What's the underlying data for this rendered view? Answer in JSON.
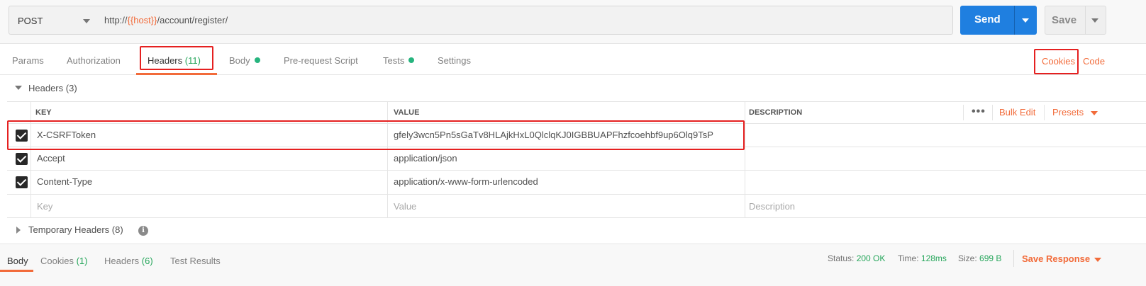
{
  "request": {
    "method": "POST",
    "url_prefix": "http://",
    "url_var": "{{host}}",
    "url_suffix": "/account/register/",
    "send_label": "Send",
    "save_label": "Save"
  },
  "request_tabs": {
    "params": "Params",
    "authorization": "Authorization",
    "headers": "Headers",
    "headers_count": "(11)",
    "body": "Body",
    "prerequest": "Pre-request Script",
    "tests": "Tests",
    "settings": "Settings",
    "cookies": "Cookies",
    "code": "Code"
  },
  "headers_section": {
    "title": "Headers",
    "count": "(3)",
    "columns": {
      "key": "KEY",
      "value": "VALUE",
      "description": "DESCRIPTION"
    },
    "bulk_edit": "Bulk Edit",
    "presets": "Presets",
    "rows": [
      {
        "key": "X-CSRFToken",
        "value": "gfely3wcn5Pn5sGaTv8HLAjkHxL0QlclqKJ0IGBBUAPFhzfcoehbf9up6Olq9TsP",
        "checked": true
      },
      {
        "key": "Accept",
        "value": "application/json",
        "checked": true
      },
      {
        "key": "Content-Type",
        "value": "application/x-www-form-urlencoded",
        "checked": true
      }
    ],
    "placeholder": {
      "key": "Key",
      "value": "Value",
      "description": "Description"
    }
  },
  "temporary_headers": {
    "title": "Temporary Headers",
    "count": "(8)",
    "info_icon": "info-icon"
  },
  "response": {
    "tabs": {
      "body": "Body",
      "cookies": "Cookies",
      "cookies_count": "(1)",
      "headers": "Headers",
      "headers_count": "(6)",
      "test_results": "Test Results"
    },
    "status_label": "Status:",
    "status_value": "200 OK",
    "time_label": "Time:",
    "time_value": "128ms",
    "size_label": "Size:",
    "size_value": "699 B",
    "save_response": "Save Response"
  },
  "colors": {
    "accent": "#f26b3a",
    "send_blue": "#1f7fe0",
    "success": "#26a65b",
    "highlight_red": "#e52020"
  }
}
